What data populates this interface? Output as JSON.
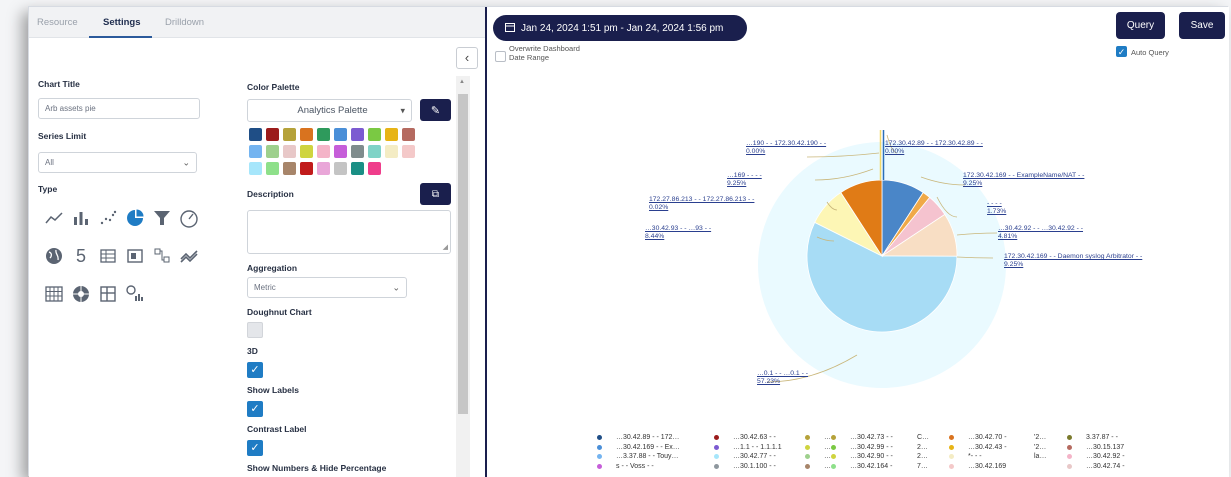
{
  "tabs": [
    "Resource",
    "Settings",
    "Drilldown"
  ],
  "chart_title": {
    "label": "Chart Title",
    "value": "Arb assets pie"
  },
  "series_limit": {
    "label": "Series Limit",
    "value": "All"
  },
  "type": {
    "label": "Type",
    "icons": [
      "line-chart-icon",
      "bar-chart-icon",
      "scatter-chart-icon",
      "pie-chart-icon",
      "funnel-chart-icon",
      "gauge-chart-icon",
      "globe-map-icon",
      "single-value-icon",
      "table-icon",
      "matrix-icon",
      "sankey-icon",
      "trend-icon",
      "heatmap-icon",
      "sunburst-icon",
      "pivot-table-icon",
      "geo-bar-icon"
    ],
    "single_value_glyph": "5"
  },
  "color_palette": {
    "label": "Color Palette",
    "value": "Analytics Palette",
    "swatches": [
      "#1f4e86",
      "#9b1c1c",
      "#b5a23a",
      "#d9731f",
      "#2e9a5c",
      "#4a8fd8",
      "#7c5bd1",
      "#7ac943",
      "#e7b416",
      "#b56a60",
      "#74b4f0",
      "#9ed08d",
      "#e8c8c8",
      "#cfd43f",
      "#f4b4c8",
      "#c65ed9",
      "#7f8c8d",
      "#7fd3c7",
      "#f4ecc4",
      "#f4c9c9",
      "#a6e6fb",
      "#8ee08a",
      "#a7856a",
      "#c11b1b",
      "#e9a6d8",
      "#c4c4c4",
      "#1a8f85",
      "#ef3d8b"
    ]
  },
  "description": {
    "label": "Description"
  },
  "aggregation": {
    "label": "Aggregation",
    "value": "Metric"
  },
  "doughnut": {
    "label": "Doughnut Chart"
  },
  "three_d": {
    "label": "3D"
  },
  "show_labels": {
    "label": "Show Labels"
  },
  "contrast_label": {
    "label": "Contrast Label"
  },
  "show_numbers": {
    "label": "Show Numbers & Hide Percentage"
  },
  "toolbar": {
    "date_range": "Jan 24, 2024 1:51 pm - Jan 24, 2024 1:56 pm",
    "query_label": "Query",
    "save_label": "Save",
    "overwrite_label_1": "Overwrite Dashboard",
    "overwrite_label_2": "Date Range",
    "auto_query_label": "Auto Query"
  },
  "chart_data": {
    "type": "pie",
    "style": "3D pie",
    "slices": [
      {
        "label": "…30.42.89 - - 172.30.42.89 - -",
        "value": 0.0,
        "color": "#f2d86b"
      },
      {
        "label": "…172.30.42.169 - - ExampleName/NAT - -",
        "value": 9.25,
        "color": "#4a86c8"
      },
      {
        "label": "… - - …",
        "value": 1.73,
        "color": "#f0a948"
      },
      {
        "label": "…30.42.92 - - …30.42.92 - -",
        "value": 4.81,
        "color": "#f5c3cf"
      },
      {
        "label": "172.30.42.169 - - …syslog Arbitrator - -",
        "value": 9.25,
        "color": "#f8dec4"
      },
      {
        "label": "…0.1 - - …0.1 - -",
        "value": 57.23,
        "color": "#a7dcf5"
      },
      {
        "label": "…30.42.93 - - …93 - -",
        "value": 8.44,
        "color": "#fdf6b5"
      },
      {
        "label": "172.27.86.213 - - 172.27.86.213 - -",
        "value": 0.02,
        "color": "#8a6a4c"
      },
      {
        "label": "…169 - - - -",
        "value": 9.25,
        "color": "#e07b16"
      },
      {
        "label": "…190 - - 172.30.42.190 - -",
        "value": 0.0,
        "color": "#2b6fb8"
      }
    ],
    "labels": [
      {
        "text": "…190 - - 172.30.42.190 - -",
        "pct": "0.00%"
      },
      {
        "text": "172.30.42.89 - - 172.30.42.89 - -",
        "pct": "0.00%"
      },
      {
        "text": "…169 - - - -",
        "pct": "9.25%"
      },
      {
        "text": "172.30.42.169 - - ExampleName/NAT - -",
        "pct": "9.25%"
      },
      {
        "text": "- - - -",
        "pct": "1.73%"
      },
      {
        "text": "172.27.86.213 - - 172.27.86.213 - -",
        "pct": "0.02%"
      },
      {
        "text": "…30.42.93 - - …93 - -",
        "pct": "8.44%"
      },
      {
        "text": "…30.42.92 - - …30.42.92 - -",
        "pct": "4.81%"
      },
      {
        "text": "172.30.42.169 - - Daemon syslog Arbitrator - -",
        "pct": "9.25%"
      },
      {
        "text": "…0.1 - - …0.1 - -",
        "pct": "57.23%"
      }
    ],
    "legend": [
      [
        {
          "t": "…30.42.89 - - 172…",
          "c": "#1f4e86"
        },
        {
          "t": "…30.42.169 - - Ex…",
          "c": "#4a8fd8"
        },
        {
          "t": "…3.37.88 - - Touy…",
          "c": "#74b4f0"
        },
        {
          "t": "s - - Voss - -",
          "c": "#c65ed9"
        }
      ],
      [
        {
          "t": "…30.42.63 - -",
          "c": "#9b1c1c"
        },
        {
          "t": "…1.1 - - 1.1.1.1",
          "c": "#7c5bd1"
        },
        {
          "t": "…30.42.77 - -",
          "c": "#a6e6fb"
        },
        {
          "t": "…30.1.100 - -",
          "c": "#8e979e"
        }
      ],
      [
        {
          "t": "…",
          "c": "#b5a23a"
        },
        {
          "t": "…",
          "c": "#cfd43f"
        },
        {
          "t": "…",
          "c": "#9ed08d"
        },
        {
          "t": "…",
          "c": "#a7856a"
        }
      ],
      [
        {
          "t": "…30.42.73 - -",
          "c": "#b5a23a"
        },
        {
          "t": "…30.42.99 - -",
          "c": "#7ac943"
        },
        {
          "t": "…30.42.90 - -",
          "c": "#cfd43f"
        },
        {
          "t": "…30.42.164 -",
          "c": "#8ee08a"
        }
      ],
      [
        {
          "t": "C…",
          "c": "#ffffff"
        },
        {
          "t": "2…",
          "c": "#ffffff"
        },
        {
          "t": "2…",
          "c": "#ffffff"
        },
        {
          "t": "7…",
          "c": "#ffffff"
        }
      ],
      [
        {
          "t": "…30.42.70 -",
          "c": "#d9731f"
        },
        {
          "t": "…30.42.43 -",
          "c": "#e7b416"
        },
        {
          "t": "*- - -",
          "c": "#f4ecc4"
        },
        {
          "t": "…30.42.169",
          "c": "#f4c9c9"
        }
      ],
      [
        {
          "t": "'2…",
          "c": "#ffffff"
        },
        {
          "t": "'2…",
          "c": "#ffffff"
        },
        {
          "t": "",
          "c": "#ffffff"
        },
        {
          "t": "la…",
          "c": "#ffffff"
        }
      ],
      [
        {
          "t": "3.37.87 - -",
          "c": "#7a7a2c"
        },
        {
          "t": "…30.15.137",
          "c": "#b56a60"
        },
        {
          "t": "…30.42.92 -",
          "c": "#f4b4c8"
        },
        {
          "t": "…30.42.74 -",
          "c": "#e8c8c8"
        }
      ]
    ]
  }
}
